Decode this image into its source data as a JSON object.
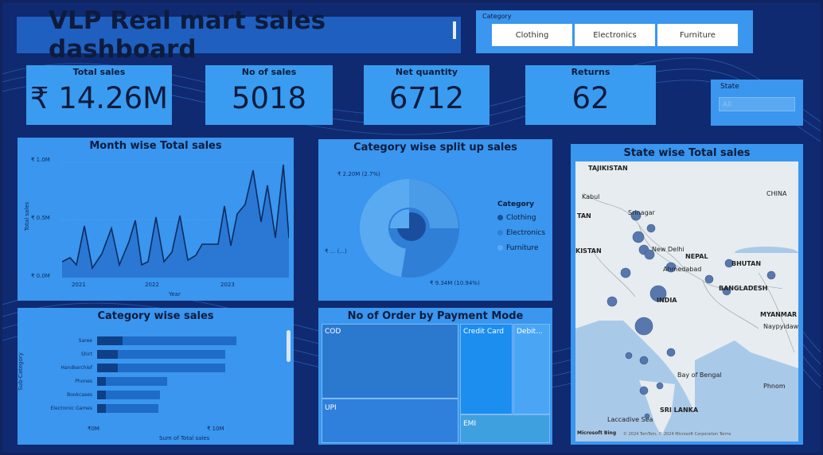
{
  "title": "VLP Real mart sales dashboard",
  "category_slicer": {
    "label": "Category",
    "options": [
      "Clothing",
      "Electronics",
      "Furniture"
    ]
  },
  "kpis": [
    {
      "label": "Total sales",
      "value": "₹ 14.26M"
    },
    {
      "label": "No of sales",
      "value": "5018"
    },
    {
      "label": "Net quantity",
      "value": "6712"
    },
    {
      "label": "Returns",
      "value": "62"
    }
  ],
  "state_slicer": {
    "label": "State",
    "value": "All"
  },
  "month_chart": {
    "title": "Month wise Total sales",
    "ylabel": "Total sales",
    "xlabel": "Year",
    "yticks": [
      "₹ 1.0M",
      "₹ 0.5M",
      "₹ 0.0M"
    ],
    "xticks": [
      "2021",
      "2022",
      "2023"
    ]
  },
  "category_split": {
    "title": "Category wise split up sales",
    "legend_title": "Category",
    "label_top": "₹ 2.20M (2.7%)",
    "label_left": "₹ ... (...)",
    "label_bottom": "₹ 9.34M (10.94%)",
    "items": [
      {
        "name": "Clothing",
        "color": "#1a4e9c"
      },
      {
        "name": "Electronics",
        "color": "#2f7fd6"
      },
      {
        "name": "Furniture",
        "color": "#5aaaf2"
      }
    ]
  },
  "state_map": {
    "title": "State wise Total sales",
    "labels": [
      "TAJIKISTAN",
      "Kabul",
      "TAN",
      "KISTAN",
      "New Delhi",
      "NEPAL",
      "BHUTAN",
      "Ahmedabad",
      "BANGLADESH",
      "INDIA",
      "MYANMAR",
      "Naypyidaw",
      "Bay of Bengal",
      "SRI LANKA",
      "Laccadive Sea",
      "CHINA",
      "Phnom",
      "Srinagar"
    ],
    "footer": "© 2024 TomTom, © 2024 Microsoft Corporation  Terms",
    "brand": "Microsoft Bing"
  },
  "category_bar": {
    "title": "Category wise sales",
    "ylabel": "Sub-Category",
    "xlabel": "Sum of Total sales",
    "xticks": [
      "₹0M",
      "₹ 10M"
    ],
    "rows": [
      {
        "name": "Saree",
        "a": 0.18,
        "b": 1.0
      },
      {
        "name": "Shirt",
        "a": 0.15,
        "b": 0.92
      },
      {
        "name": "Handkerchief",
        "a": 0.15,
        "b": 0.92
      },
      {
        "name": "Phones",
        "a": 0.06,
        "b": 0.5
      },
      {
        "name": "Bookcases",
        "a": 0.06,
        "b": 0.45
      },
      {
        "name": "Electronic Games",
        "a": 0.06,
        "b": 0.44
      }
    ]
  },
  "payment": {
    "title": "No of Order by Payment Mode",
    "modes": [
      "COD",
      "UPI",
      "Credit Card",
      "Debit...",
      "EMI"
    ]
  }
}
